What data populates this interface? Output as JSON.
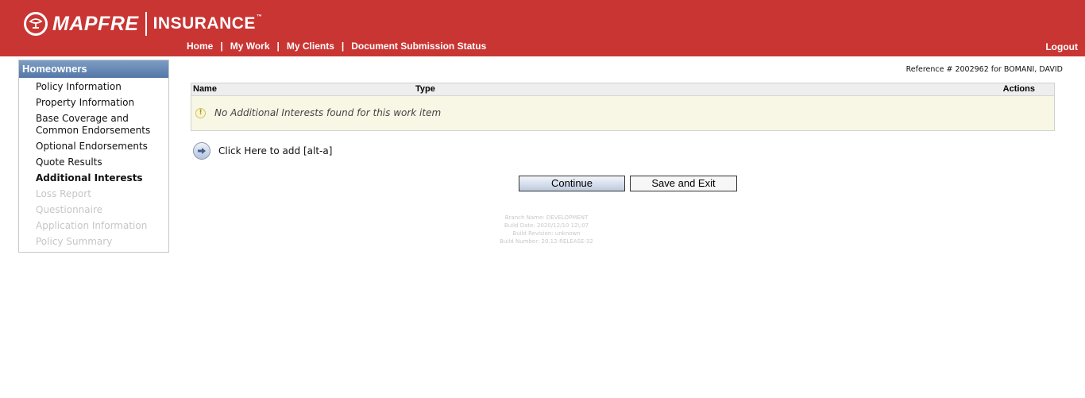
{
  "header": {
    "brand": "MAPFRE",
    "product": "INSURANCE",
    "trademark": "™",
    "nav": [
      "Home",
      "My Work",
      "My Clients",
      "Document Submission Status"
    ],
    "nav_separator": "|",
    "logout": "Logout"
  },
  "sidebar": {
    "title": "Homeowners",
    "items": [
      {
        "label": "Policy Information",
        "state": "enabled"
      },
      {
        "label": "Property Information",
        "state": "enabled"
      },
      {
        "label": "Base Coverage and Common Endorsements",
        "state": "enabled"
      },
      {
        "label": "Optional Endorsements",
        "state": "enabled"
      },
      {
        "label": "Quote Results",
        "state": "enabled"
      },
      {
        "label": "Additional Interests",
        "state": "active"
      },
      {
        "label": "Loss Report",
        "state": "disabled"
      },
      {
        "label": "Questionnaire",
        "state": "disabled"
      },
      {
        "label": "Application Information",
        "state": "disabled"
      },
      {
        "label": "Policy Summary",
        "state": "disabled"
      }
    ]
  },
  "reference": "Reference # 2002962 for BOMANI, DAVID",
  "table": {
    "columns": {
      "name": "Name",
      "type": "Type",
      "actions": "Actions"
    },
    "empty_message": "No Additional Interests found for this work item"
  },
  "add_link": "Click Here to add [alt-a]",
  "buttons": {
    "continue": "Continue",
    "save_exit": "Save and Exit"
  },
  "build_info": [
    "Branch Name: DEVELOPMENT",
    "Build Date: 2020/12/10 12\\:07",
    "Build Revision: unknown",
    "Build Number: 20.12-RELEASE-32"
  ],
  "colors": {
    "header_bg": "#c93533",
    "sidebar_title_bg": "#5577a8",
    "table_body_bg": "#f8f7e6"
  },
  "icons": {
    "logo": "mapfre-logo-icon",
    "empty_message": "exclamation-icon",
    "add_link": "arrow-right-icon"
  }
}
